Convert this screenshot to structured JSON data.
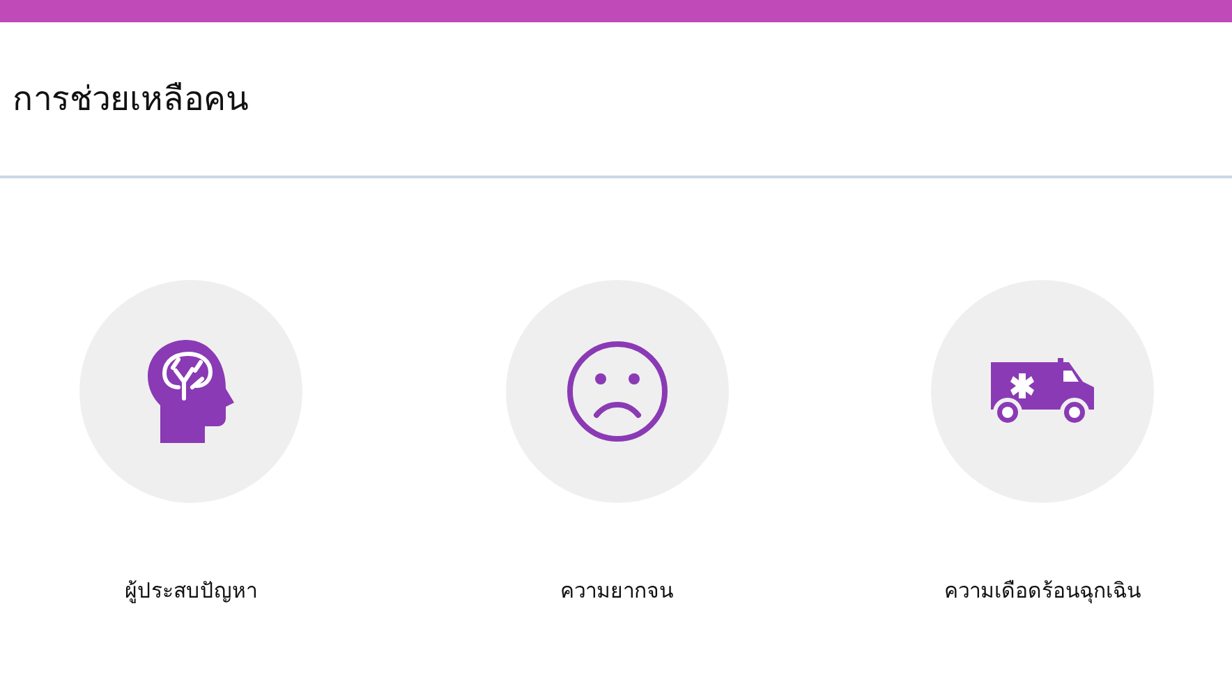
{
  "page_title": "การช่วยเหลือคน",
  "categories": [
    {
      "kind": "brain",
      "label": "ผู้ประสบปัญหา"
    },
    {
      "kind": "sad",
      "label": "ความยากจน"
    },
    {
      "kind": "ambulance",
      "label": "ความเดือดร้อนฉุกเฉิน"
    }
  ]
}
